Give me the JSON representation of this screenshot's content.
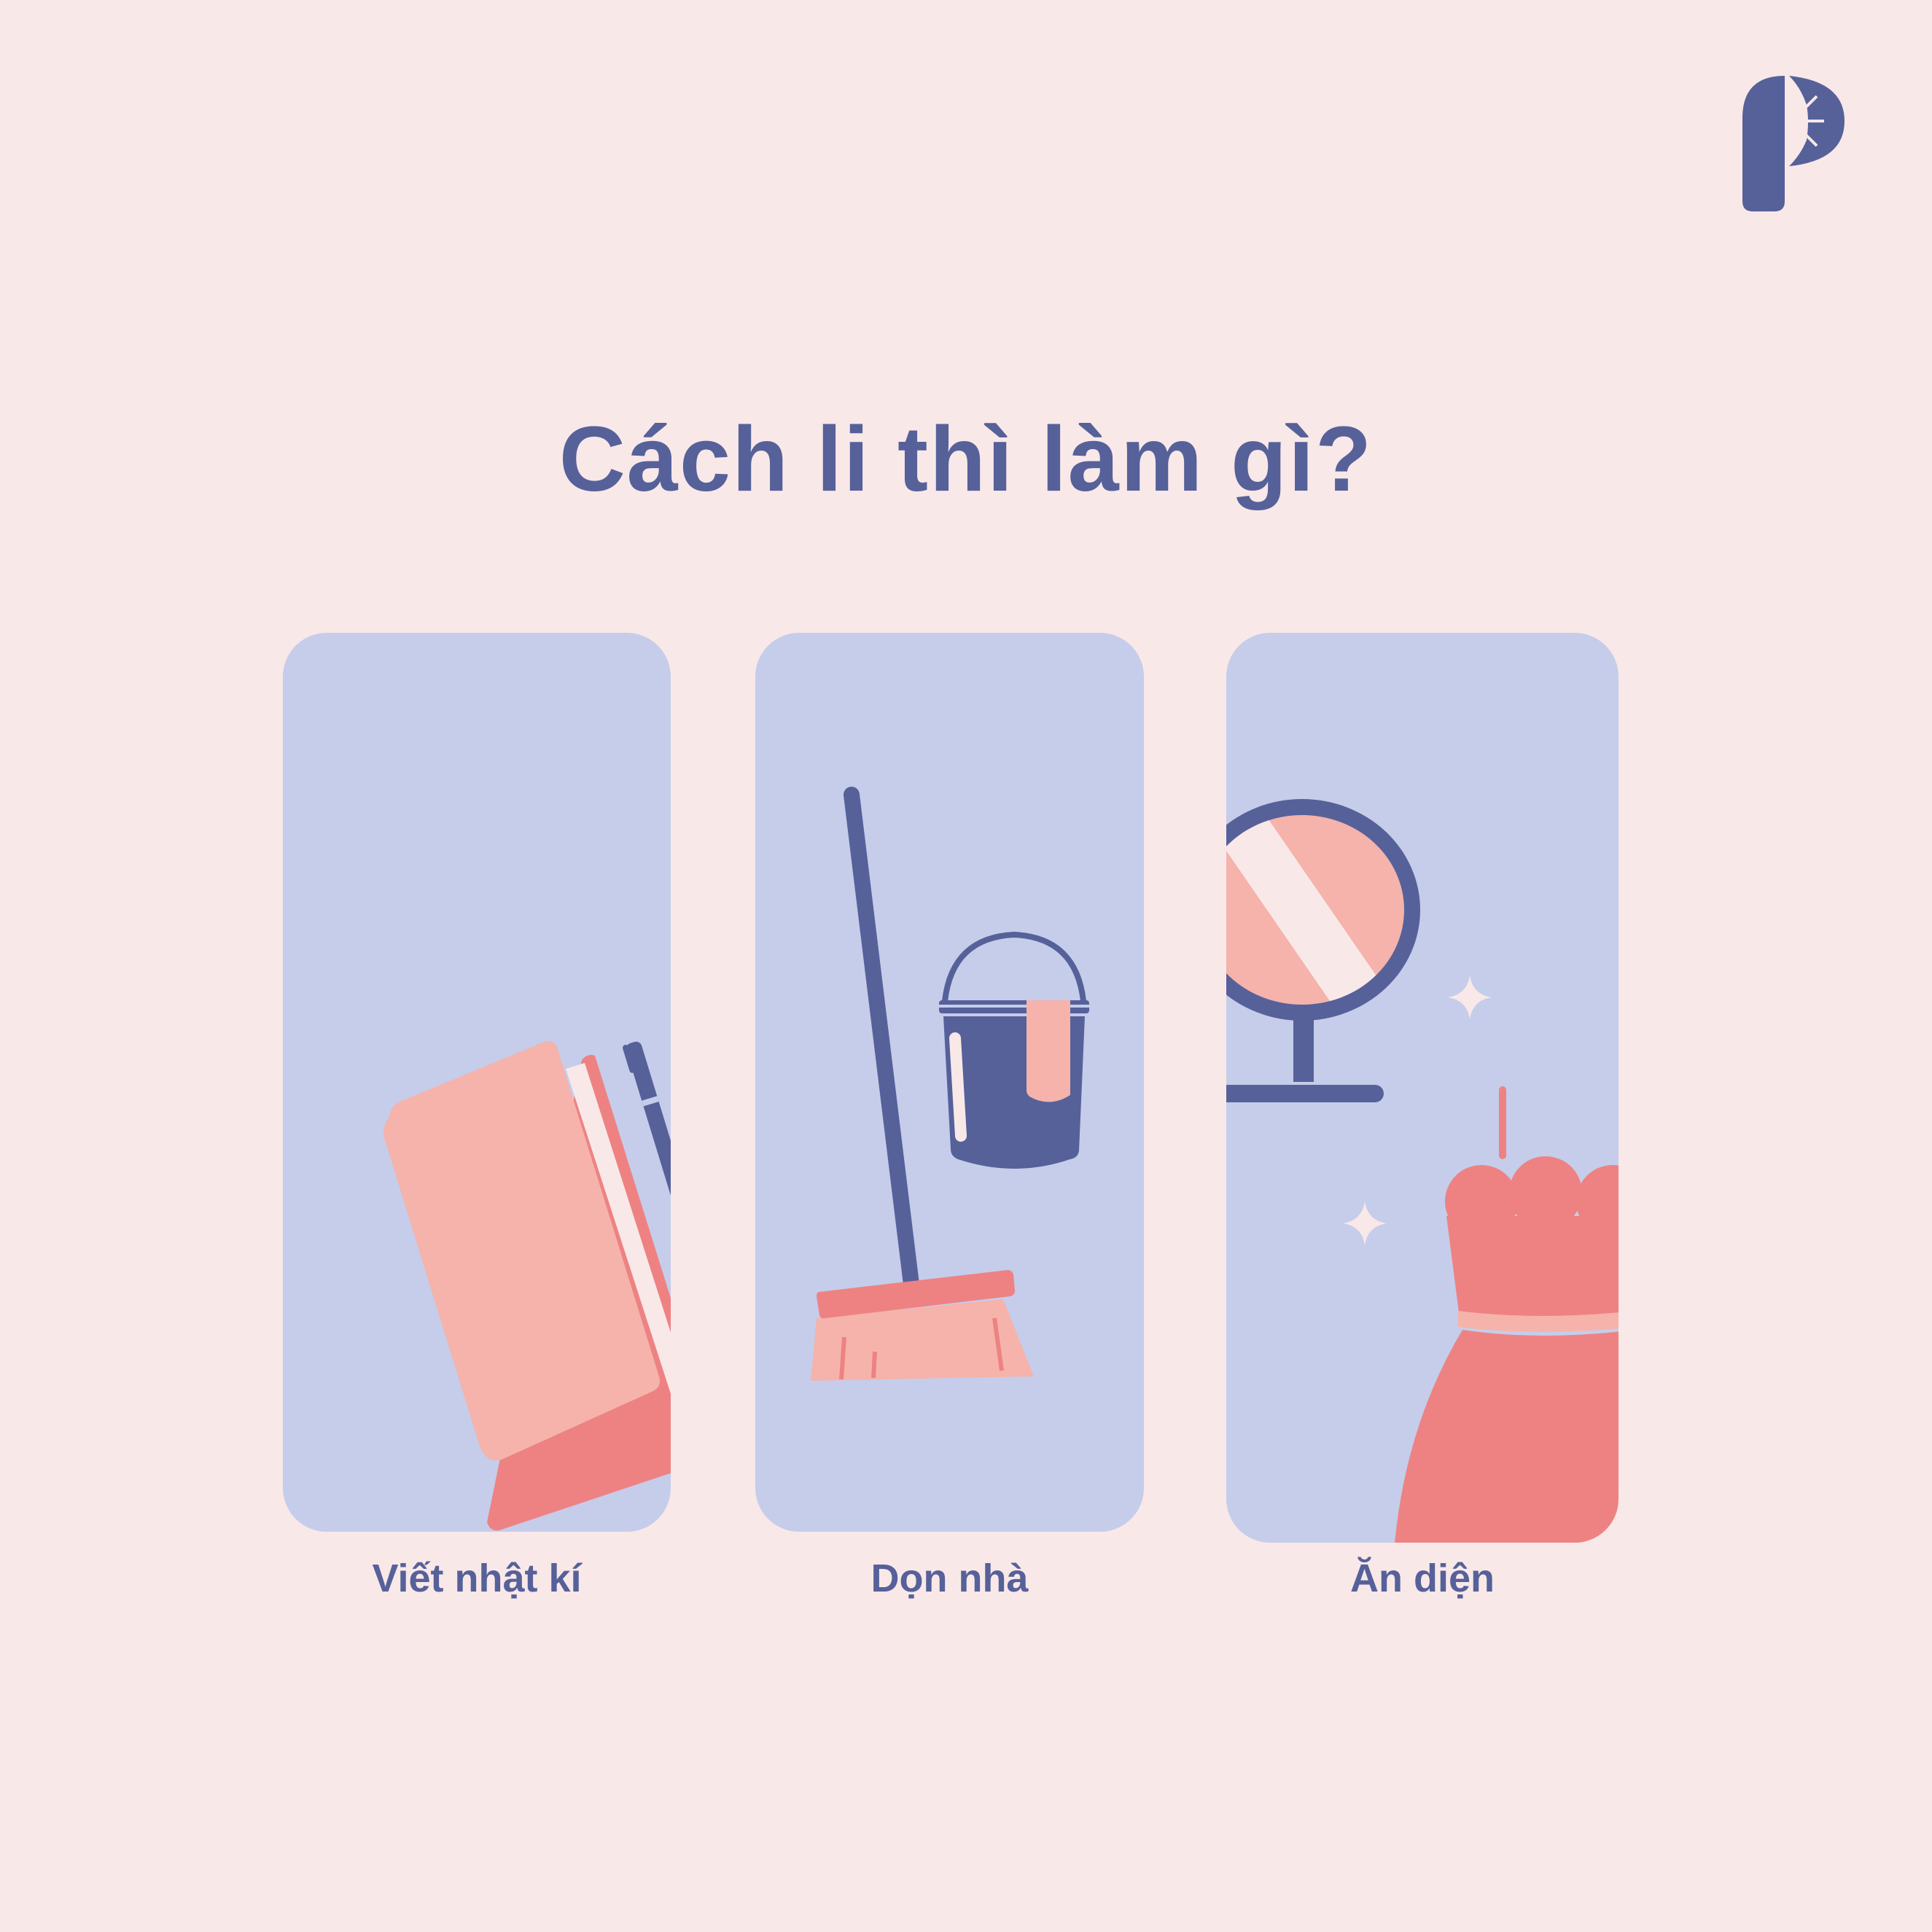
{
  "title": "Cách li thì làm gì?",
  "cards": [
    {
      "label": "Viết nhật kí",
      "icon": "journal-icon"
    },
    {
      "label": "Dọn nhà",
      "icon": "broom-bucket-icon"
    },
    {
      "label": "Ăn diện",
      "icon": "mirror-dress-icon"
    }
  ],
  "colors": {
    "background": "#f9e8e8",
    "card": "#c5cdea",
    "navy": "#56619a",
    "light_pink": "#f5b3ab",
    "coral": "#ee8282"
  }
}
